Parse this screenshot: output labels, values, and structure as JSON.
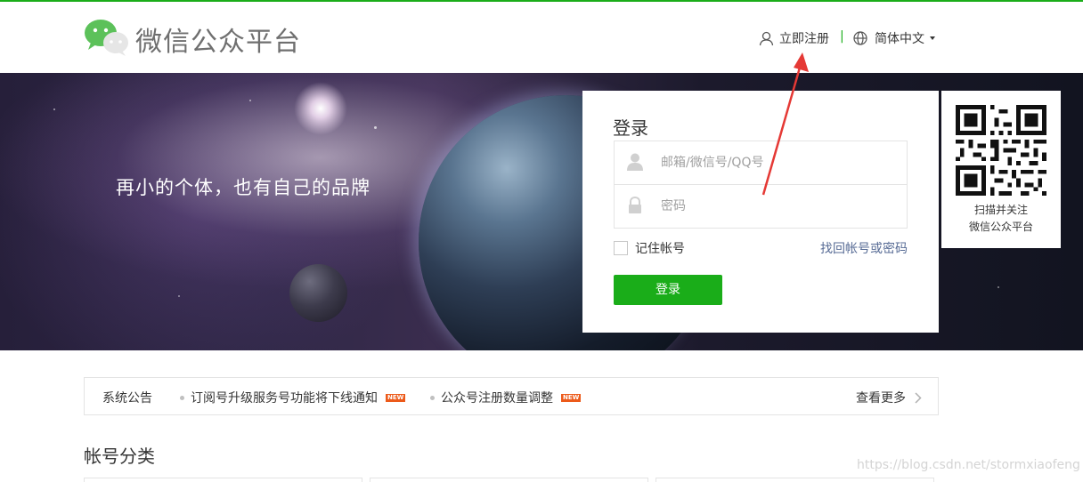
{
  "header": {
    "logo_text": "微信公众平台",
    "register_label": "立即注册",
    "separator": "|",
    "language_label": "简体中文"
  },
  "banner": {
    "slogan": "再小的个体，也有自己的品牌"
  },
  "login": {
    "title": "登录",
    "username_placeholder": "邮箱/微信号/QQ号",
    "password_placeholder": "密码",
    "remember_label": "记住帐号",
    "forgot_label": "找回帐号或密码",
    "submit_label": "登录"
  },
  "qr": {
    "line1": "扫描并关注",
    "line2": "微信公众平台"
  },
  "notice": {
    "title": "系统公告",
    "items": [
      {
        "text": "订阅号升级服务号功能将下线通知",
        "badge": "NEW"
      },
      {
        "text": "公众号注册数量调整",
        "badge": "NEW"
      }
    ],
    "more_label": "查看更多"
  },
  "section": {
    "title": "帐号分类"
  },
  "watermark": "https://blog.csdn.net/stormxiaofeng",
  "colors": {
    "brand_green": "#1aad19",
    "link_blue": "#576b95",
    "annotation_red": "#e53935"
  }
}
